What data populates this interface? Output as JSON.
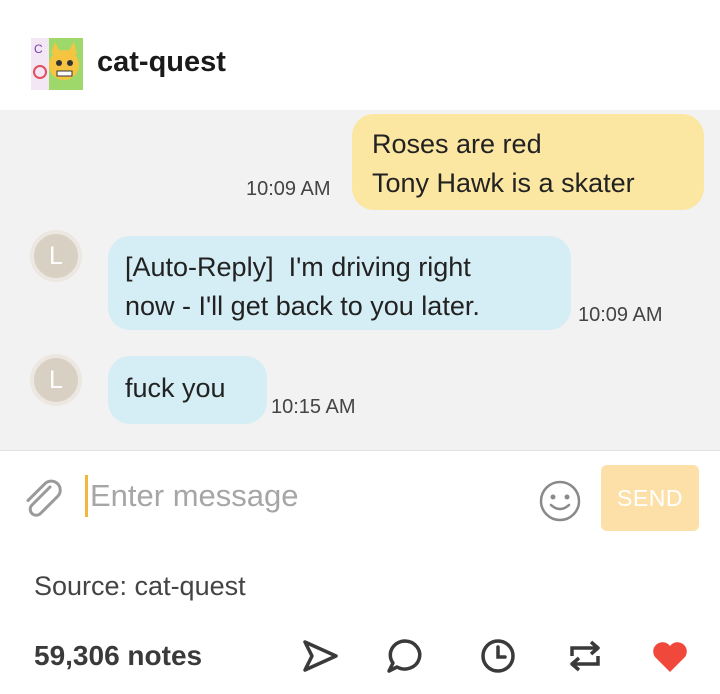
{
  "post": {
    "blog_name": "cat-quest",
    "source_label": "Source: cat-quest",
    "notes_count": "59,306 notes"
  },
  "chat": {
    "messages": [
      {
        "direction": "sent",
        "lines": [
          "Roses are red",
          "Tony Hawk is a skater"
        ],
        "time": "10:09 AM"
      },
      {
        "direction": "received",
        "avatar_initial": "L",
        "lines": [
          "[Auto-Reply]  I'm driving right",
          "now - I'll get back to you later."
        ],
        "time": "10:09 AM"
      },
      {
        "direction": "received",
        "avatar_initial": "L",
        "lines": [
          "fuck you"
        ],
        "time": "10:15 AM"
      }
    ],
    "input_placeholder": "Enter message",
    "send_label": "SEND",
    "icons": {
      "attach": "paperclip-icon",
      "emoji": "smiley-icon"
    }
  },
  "actions": {
    "icons": [
      "share-icon",
      "reply-icon",
      "history-icon",
      "reblog-icon",
      "heart-icon"
    ],
    "like_color": "#f0493b"
  },
  "colors": {
    "sent_bubble": "#fbe6a2",
    "received_bubble": "#d5edf4",
    "send_button": "#fde0a8",
    "chat_background": "#f2f2f2"
  }
}
